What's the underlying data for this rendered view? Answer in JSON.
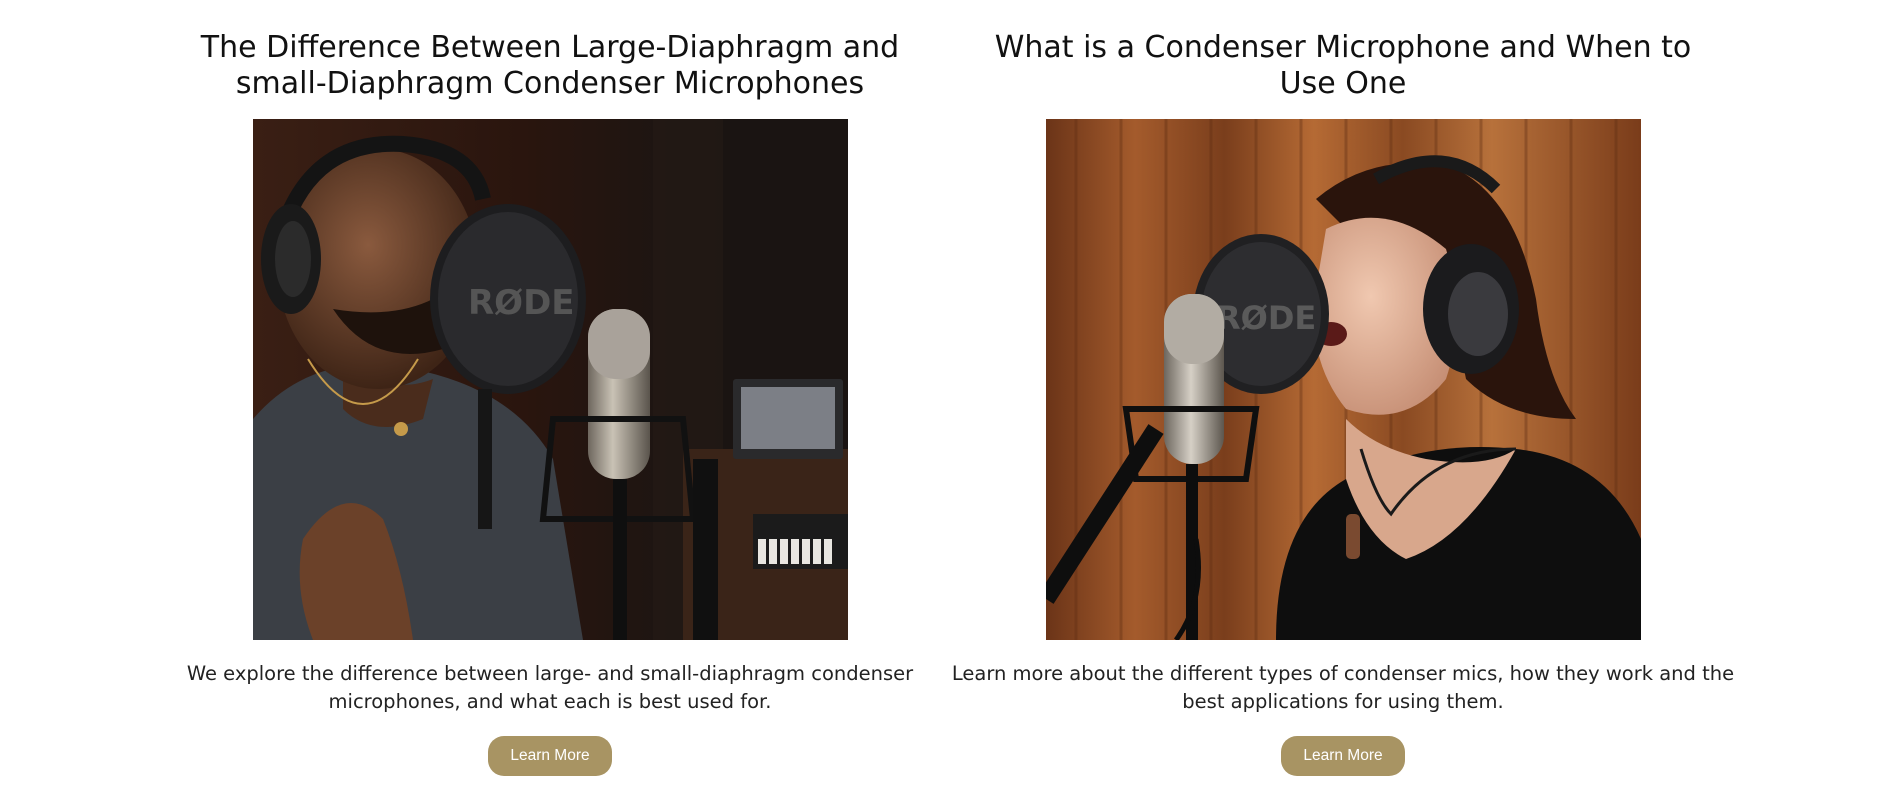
{
  "articles": [
    {
      "title": "The Difference Between Large-Diaphragm and small-Diaphragm Condenser Microphones",
      "description": "We explore the difference between large- and small-diaphragm condenser microphones, and what each is best used for.",
      "button_label": "Learn More",
      "image_brand_text": "RØDE"
    },
    {
      "title": "What is a Condenser Microphone and When to Use One",
      "description": "Learn more about the different types of condenser mics, how they work and the best applications for using them.",
      "button_label": "Learn More",
      "image_brand_text": "RØDE"
    }
  ],
  "colors": {
    "button": "#a89463",
    "text": "#1a1a1a",
    "background": "#ffffff"
  }
}
